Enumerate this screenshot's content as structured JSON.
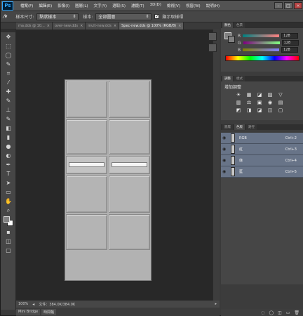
{
  "app": {
    "logo": "Ps"
  },
  "menu": [
    "檔案(F)",
    "編輯(E)",
    "影像(I)",
    "圖層(L)",
    "文字(Y)",
    "選取(S)",
    "濾鏡(T)",
    "3D(D)",
    "檢視(V)",
    "視窗(W)",
    "說明(H)"
  ],
  "window_controls": [
    "–",
    "□",
    "×"
  ],
  "options": {
    "sample_size_label": "樣本尺寸:",
    "sample_size_value": "點狀樣本",
    "sample_label": "樣本:",
    "sample_value": "全部圖層",
    "show_ring_label": "顯示取樣環"
  },
  "tools": [
    "move-tool",
    "marquee-tool",
    "lasso-tool",
    "quick-select-tool",
    "crop-tool",
    "eyedropper-tool",
    "healing-tool",
    "brush-tool",
    "stamp-tool",
    "history-brush-tool",
    "eraser-tool",
    "gradient-tool",
    "blur-tool",
    "dodge-tool",
    "pen-tool",
    "type-tool",
    "path-select-tool",
    "shape-tool",
    "hand-tool",
    "zoom-tool"
  ],
  "tool_glyphs": [
    "✥",
    "⬚",
    "◯",
    "✎",
    "⌗",
    "⁄",
    "✚",
    "✎",
    "⊥",
    "✎",
    "◧",
    "▮",
    "●",
    "◐",
    "✒",
    "T",
    "➤",
    "▭",
    "✋",
    "⌕",
    "▪",
    "◫",
    "▢"
  ],
  "tabs": [
    {
      "label": "ma.dds @ 10..."
    },
    {
      "label": "over-new.dds"
    },
    {
      "label": "mult-new.dds"
    },
    {
      "label": "Spec-new.dds @ 100% (RGB/8)",
      "active": true
    }
  ],
  "status": {
    "zoom": "100%",
    "doc_info": "文件：384.0K/384.0K"
  },
  "bottom_tabs": [
    "Mini Bridge",
    "時間軸"
  ],
  "color_panel": {
    "tabs": [
      "顏色",
      "色票"
    ],
    "channels": [
      {
        "label": "R",
        "value": "128"
      },
      {
        "label": "G",
        "value": "128"
      },
      {
        "label": "B",
        "value": "128"
      }
    ]
  },
  "adjust_panel": {
    "tabs": [
      "調整",
      "樣式"
    ],
    "title": "增加調整",
    "icons_row1": [
      "☀",
      "▦",
      "◪",
      "▨",
      "▽"
    ],
    "icons_row2": [
      "▥",
      "⚖",
      "▣",
      "◉",
      "▤"
    ],
    "icons_row3": [
      "◩",
      "◨",
      "◪",
      "◫",
      "▢"
    ]
  },
  "channels_panel": {
    "tabs": [
      "圖層",
      "色版",
      "路徑"
    ],
    "rows": [
      {
        "name": "RGB",
        "shortcut": "Ctrl+2"
      },
      {
        "name": "紅",
        "shortcut": "Ctrl+3"
      },
      {
        "name": "綠",
        "shortcut": "Ctrl+4"
      },
      {
        "name": "藍",
        "shortcut": "Ctrl+5"
      }
    ],
    "footer_icons": [
      "◌",
      "◯",
      "◫",
      "▭",
      "🗑"
    ]
  },
  "colors": {
    "accent": "#31a8ff",
    "channel_row": "#687488"
  }
}
